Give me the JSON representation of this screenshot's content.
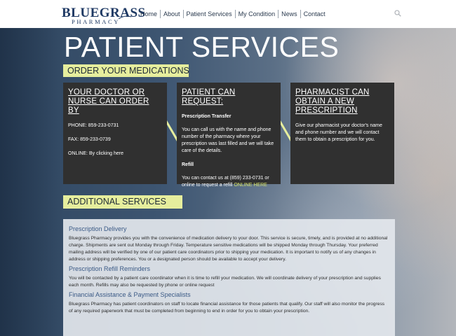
{
  "header": {
    "logo_main": "BLUEGRASS",
    "logo_sub": "PHARMACY",
    "nav": [
      "Home",
      "About",
      "Patient Services",
      "My Condition",
      "News",
      "Contact"
    ]
  },
  "page": {
    "title": "PATIENT SERVICES",
    "order_band": "ORDER YOUR MEDICATIONS",
    "additional_band": "ADDITIONAL SERVICES"
  },
  "cards": {
    "doctor": {
      "title": "YOUR DOCTOR OR NURSE CAN ORDER BY",
      "phone": "PHONE: 859-233-0731",
      "fax": "FAX: 859-233-0739",
      "online": "ONLINE: By clicking here"
    },
    "patient": {
      "title": "PATIENT CAN REQUEST:",
      "transfer_heading": "Prescription Transfer",
      "transfer_text": "You can call us with the name and phone number of the pharmacy where your prescription was last filled and we will take care of the details.",
      "refill_heading": "Refill",
      "refill_text": "You can contact us at (859) 233-0731 or online to request a refill",
      "refill_link": "ONLINE HERE"
    },
    "pharmacist": {
      "title": "PHARMACIST CAN OBTAIN A NEW PRESCRIPTION",
      "text": "Give our pharmacist your doctor's name and phone number and we will contact them to obtain a prescription for you."
    }
  },
  "services": [
    {
      "title": "Prescription Delivery",
      "body": "Bluegrass Pharmacy provides you with the convenience of medication delivery to your door. This service is secure, timely, and is provided at no additional charge. Shipments are sent out Monday through Friday. Temperature sensitive medications will be shipped Monday through Thursday. Your preferred mailing address will be verified by one of our patient care coordinators prior to shipping your medication. It is important to notify us of any changes in address or shipping preferences. You or a designated person should be available to accept your delivery."
    },
    {
      "title": "Prescription Refill Reminders",
      "body": "You will be contacted by a patient care coordinator when it is time to refill your medication. We will coordinate delivery of your prescription and supplies each month. Refills may also be requested by phone or online request"
    },
    {
      "title": "Financial Assistance & Payment Specialists",
      "body": "Bluegrass Pharmacy has patient coordinators on staff to locate financial assistance for those patients that qualify. Our staff will also monitor the progress of any required paperwork that must be completed from beginning to end in order for you to obtain your prescription."
    }
  ],
  "colors": {
    "band": "#e6ee9d",
    "card": "#303030",
    "accent": "#d9e66e",
    "logo": "#1f3a64",
    "service_title": "#3b5a86"
  }
}
